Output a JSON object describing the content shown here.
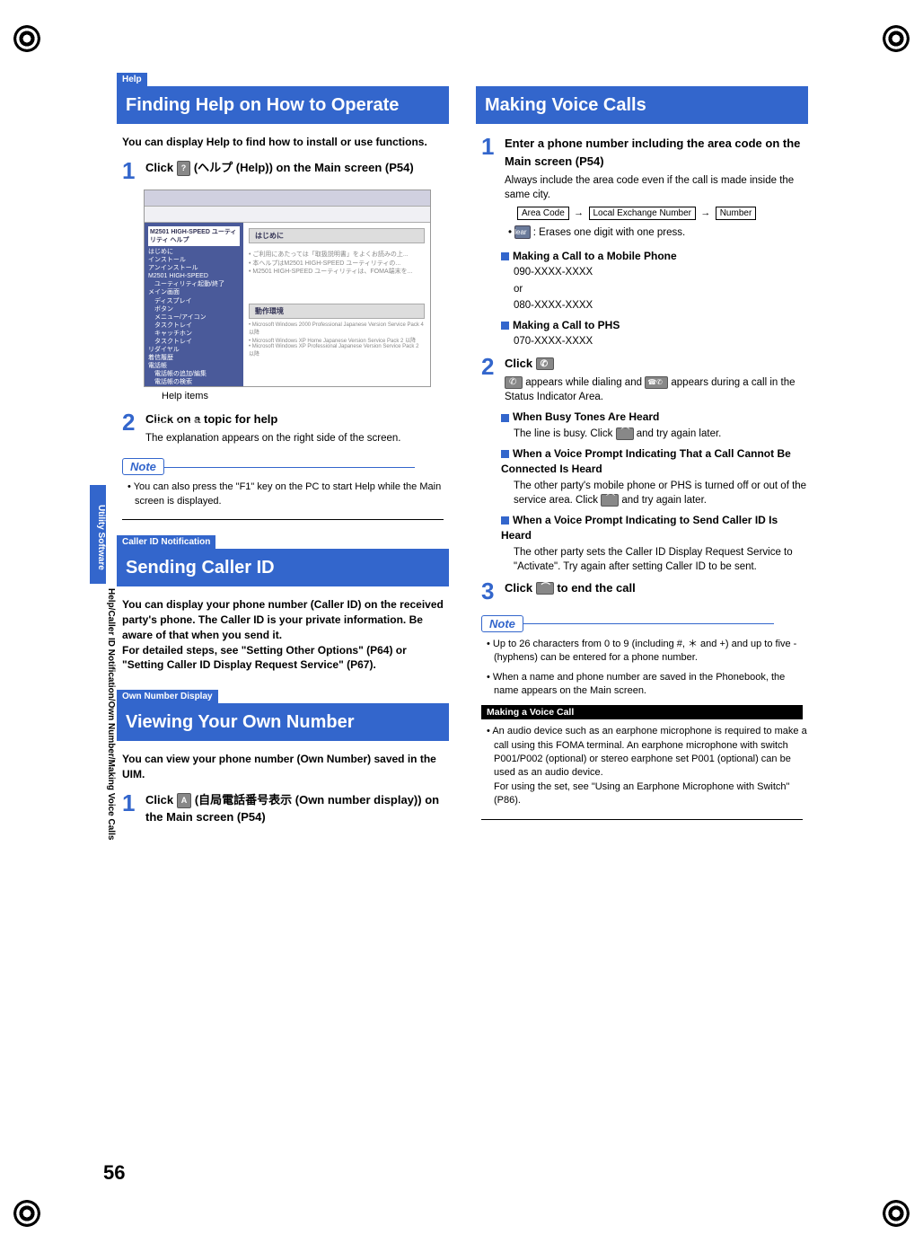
{
  "page_number": "56",
  "side_tab": "Utility Software",
  "side_text": "Help/Caller ID Notification/Own Number/Making Voice Calls",
  "left": {
    "help_tag": "Help",
    "help_title": "Finding Help on How to Operate",
    "help_intro": "You can display Help to find how to install or use functions.",
    "step1_num": "1",
    "step1_title_a": "Click ",
    "step1_title_b": " (ヘルプ (Help)) on the Main screen (P54)",
    "help_icon": "?",
    "help_items": "Help items",
    "step2_num": "2",
    "step2_title": "Click on a topic for help",
    "step2_text": "The explanation appears on the right side of the screen.",
    "note_label": "Note",
    "note1": "You can also press the \"F1\" key on the PC to start Help while the Main screen is displayed.",
    "caller_tag": "Caller ID Notification",
    "caller_title": "Sending Caller ID",
    "caller_intro": "You can display your phone number (Caller ID) on the received party's phone. The Caller ID is your private information. Be aware of that when you send it.\nFor detailed steps, see \"Setting Other Options\" (P64) or \"Setting Caller ID Display Request Service\" (P67).",
    "own_tag": "Own Number Display",
    "own_title": "Viewing Your Own Number",
    "own_intro": "You can view your phone number (Own Number) saved in the UIM.",
    "own_step1_num": "1",
    "own_step1_a": "Click ",
    "own_step1_b": " (自局電話番号表示 (Own number display)) on the Main screen (P54)",
    "own_icon": "A"
  },
  "right": {
    "voice_title": "Making Voice Calls",
    "step1_num": "1",
    "step1_title": "Enter a phone number including the area code on the Main screen (P54)",
    "step1_text": "Always include the area code even if the call is made inside the same city.",
    "flow_area": "Area Code",
    "flow_local": "Local Exchange Number",
    "flow_number": "Number",
    "clear_label": "clear",
    "clear_text": " : Erases one digit with one press.",
    "mobile_head": "Making a Call to a Mobile Phone",
    "mobile_line1": "090-XXXX-XXXX",
    "mobile_or": "or",
    "mobile_line2": "080-XXXX-XXXX",
    "phs_head": "Making a Call to PHS",
    "phs_line": "070-XXXX-XXXX",
    "step2_num": "2",
    "step2_title": "Click ",
    "step2_text_a": " appears while dialing and ",
    "step2_text_b": " appears during a call in the Status Indicator Area.",
    "busy_head": "When Busy Tones Are Heard",
    "busy_text_a": "The line is busy. Click ",
    "busy_text_b": " and try again later.",
    "cannot_head": "When a Voice Prompt Indicating That a Call Cannot Be Connected Is Heard",
    "cannot_text_a": "The other party's mobile phone or PHS is turned off or out of the service area. Click ",
    "cannot_text_b": " and try again later.",
    "sendid_head": "When a Voice Prompt Indicating to Send Caller ID Is Heard",
    "sendid_text": "The other party sets the Caller ID Display Request Service to \"Activate\". Try again after setting Caller ID to be sent.",
    "step3_num": "3",
    "step3_a": "Click ",
    "step3_b": " to end the call",
    "note_label": "Note",
    "note1": "Up to 26 characters from 0 to 9 (including #, ＊ and +) and up to five - (hyphens) can be entered for a phone number.",
    "note2": "When a name and phone number are saved in the Phonebook, the name appears on the Main screen.",
    "black_bar": "Making a Voice Call",
    "audio_note": "An audio device such as an earphone microphone is required to make a call using this FOMA terminal. An earphone microphone with switch P001/P002 (optional) or stereo earphone set P001 (optional) can be used as an audio device.\nFor using the set, see \"Using an Earphone Microphone with Switch\" (P86)."
  },
  "screenshot": {
    "title": "M2501 HIGH-SPEED ユーティリティ ヘルプ",
    "main_heading": "はじめに",
    "side_items": "はじめに\nインストール\nアンインストール\nM2501 HIGH-SPEED\n　ユーティリティ起動/終了\nメイン画面\n　ディスプレイ\n　ボタン\n　メニュー/アイコン\n　タスクトレイ\n　キャッチホン\n　タスクトレイ\nリダイヤル\n着信履歴\n電話帳\n　電話帳の追加/編集\n　電話帳の検索\n　電話帳のインポート/エクスポート\n各種設定\n　表示設定\n　セキュリティ設定\n　PINコード解除"
  }
}
